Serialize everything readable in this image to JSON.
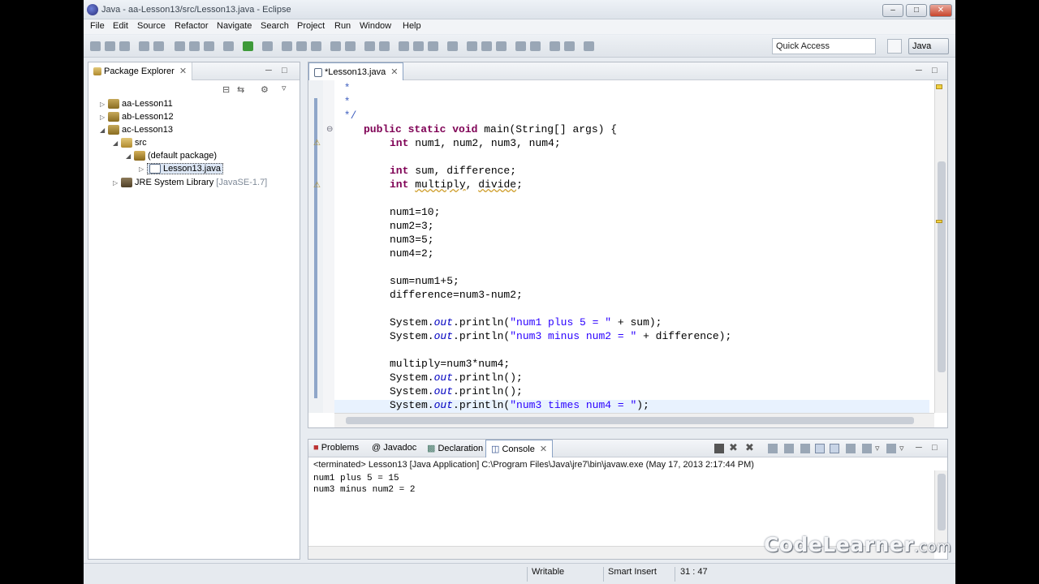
{
  "window": {
    "title": "Java - aa-Lesson13/src/Lesson13.java - Eclipse"
  },
  "menu": [
    "File",
    "Edit",
    "Source",
    "Refactor",
    "Navigate",
    "Search",
    "Project",
    "Run",
    "Window",
    "Help"
  ],
  "toolbar": {
    "quick_access": "Quick Access",
    "perspective": "Java"
  },
  "package_explorer": {
    "tab": "Package Explorer",
    "tree": [
      {
        "label": "aa-Lesson11",
        "icon": "project-icon"
      },
      {
        "label": "ab-Lesson12",
        "icon": "project-icon"
      },
      {
        "label": "ac-Lesson13",
        "icon": "project-icon"
      },
      {
        "label": "src",
        "icon": "source-folder-icon"
      },
      {
        "label": "(default package)",
        "icon": "package-icon"
      },
      {
        "label": "Lesson13.java",
        "icon": "java-file-icon"
      },
      {
        "label": "JRE System Library",
        "suffix": "[JavaSE-1.7]",
        "icon": "library-icon"
      }
    ]
  },
  "editor": {
    "tab": "*Lesson13.java",
    "lines": [
      " *",
      " *",
      " */",
      "public static void main(String[] args) {",
      "    int num1, num2, num3, num4;",
      "",
      "    int sum, difference;",
      "    int multiply, divide;",
      "",
      "    num1=10;",
      "    num2=3;",
      "    num3=5;",
      "    num4=2;",
      "",
      "    sum=num1+5;",
      "    difference=num3-num2;",
      "",
      "    System.out.println(\"num1 plus 5 = \" + sum);",
      "    System.out.println(\"num3 minus num2 = \" + difference);",
      "",
      "    multiply=num3*num4;",
      "    System.out.println();",
      "    System.out.println();",
      "    System.out.println(\"num3 times num4 = \");"
    ]
  },
  "console": {
    "tabs": [
      "Problems",
      "Javadoc",
      "Declaration",
      "Console"
    ],
    "header": "<terminated> Lesson13 [Java Application] C:\\Program Files\\Java\\jre7\\bin\\javaw.exe (May 17, 2013 2:17:44 PM)",
    "output": [
      "num1 plus 5 = 15",
      "num3 minus num2 = 2"
    ]
  },
  "status": {
    "writable": "Writable",
    "insert_mode": "Smart Insert",
    "position": "31 : 47"
  },
  "watermark": {
    "main": "CodeLearner",
    "suffix": ".com"
  }
}
